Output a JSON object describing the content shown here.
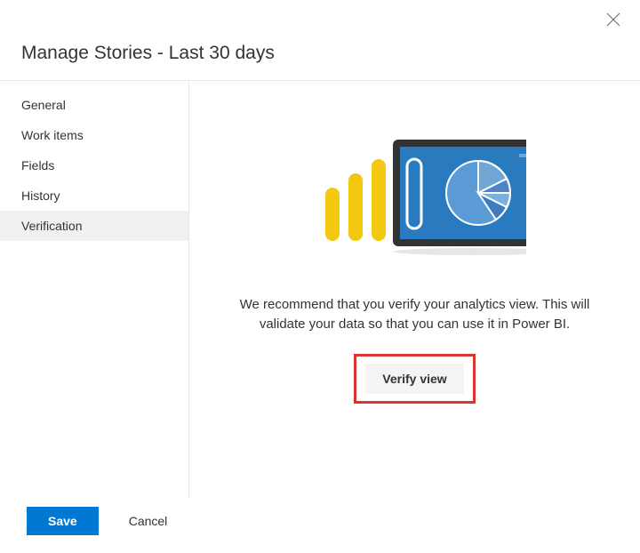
{
  "header": {
    "title": "Manage Stories - Last 30 days"
  },
  "sidebar": {
    "items": [
      {
        "label": "General"
      },
      {
        "label": "Work items"
      },
      {
        "label": "Fields"
      },
      {
        "label": "History"
      },
      {
        "label": "Verification"
      }
    ]
  },
  "main": {
    "message": "We recommend that you verify your analytics view. This will validate your data so that you can use it in Power BI.",
    "verify_label": "Verify view"
  },
  "footer": {
    "save_label": "Save",
    "cancel_label": "Cancel"
  },
  "icons": {
    "close": "close-icon",
    "chart": "chart-illustration-icon"
  }
}
